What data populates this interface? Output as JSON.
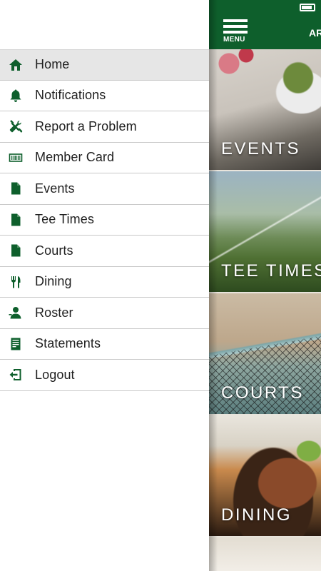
{
  "drawer": {
    "items": [
      {
        "label": "Home",
        "icon": "home-icon",
        "active": true
      },
      {
        "label": "Notifications",
        "icon": "bell-icon",
        "active": false
      },
      {
        "label": "Report a Problem",
        "icon": "tools-icon",
        "active": false
      },
      {
        "label": "Member Card",
        "icon": "barcode-icon",
        "active": false
      },
      {
        "label": "Events",
        "icon": "document-icon",
        "active": false
      },
      {
        "label": "Tee Times",
        "icon": "document-icon",
        "active": false
      },
      {
        "label": "Courts",
        "icon": "document-icon",
        "active": false
      },
      {
        "label": "Dining",
        "icon": "fork-knife-icon",
        "active": false
      },
      {
        "label": "Roster",
        "icon": "person-icon",
        "active": false
      },
      {
        "label": "Statements",
        "icon": "statement-icon",
        "active": false
      },
      {
        "label": "Logout",
        "icon": "logout-icon",
        "active": false
      }
    ]
  },
  "topbar": {
    "menu_label": "MENU",
    "cutoff_text": "AR"
  },
  "tiles": [
    {
      "label": "EVENTS"
    },
    {
      "label": "TEE TIMES"
    },
    {
      "label": "COURTS"
    },
    {
      "label": "DINING"
    }
  ],
  "colors": {
    "brand_green": "#0e5f2c",
    "active_row": "#e6e6e6",
    "divider": "#c9c9c9"
  }
}
